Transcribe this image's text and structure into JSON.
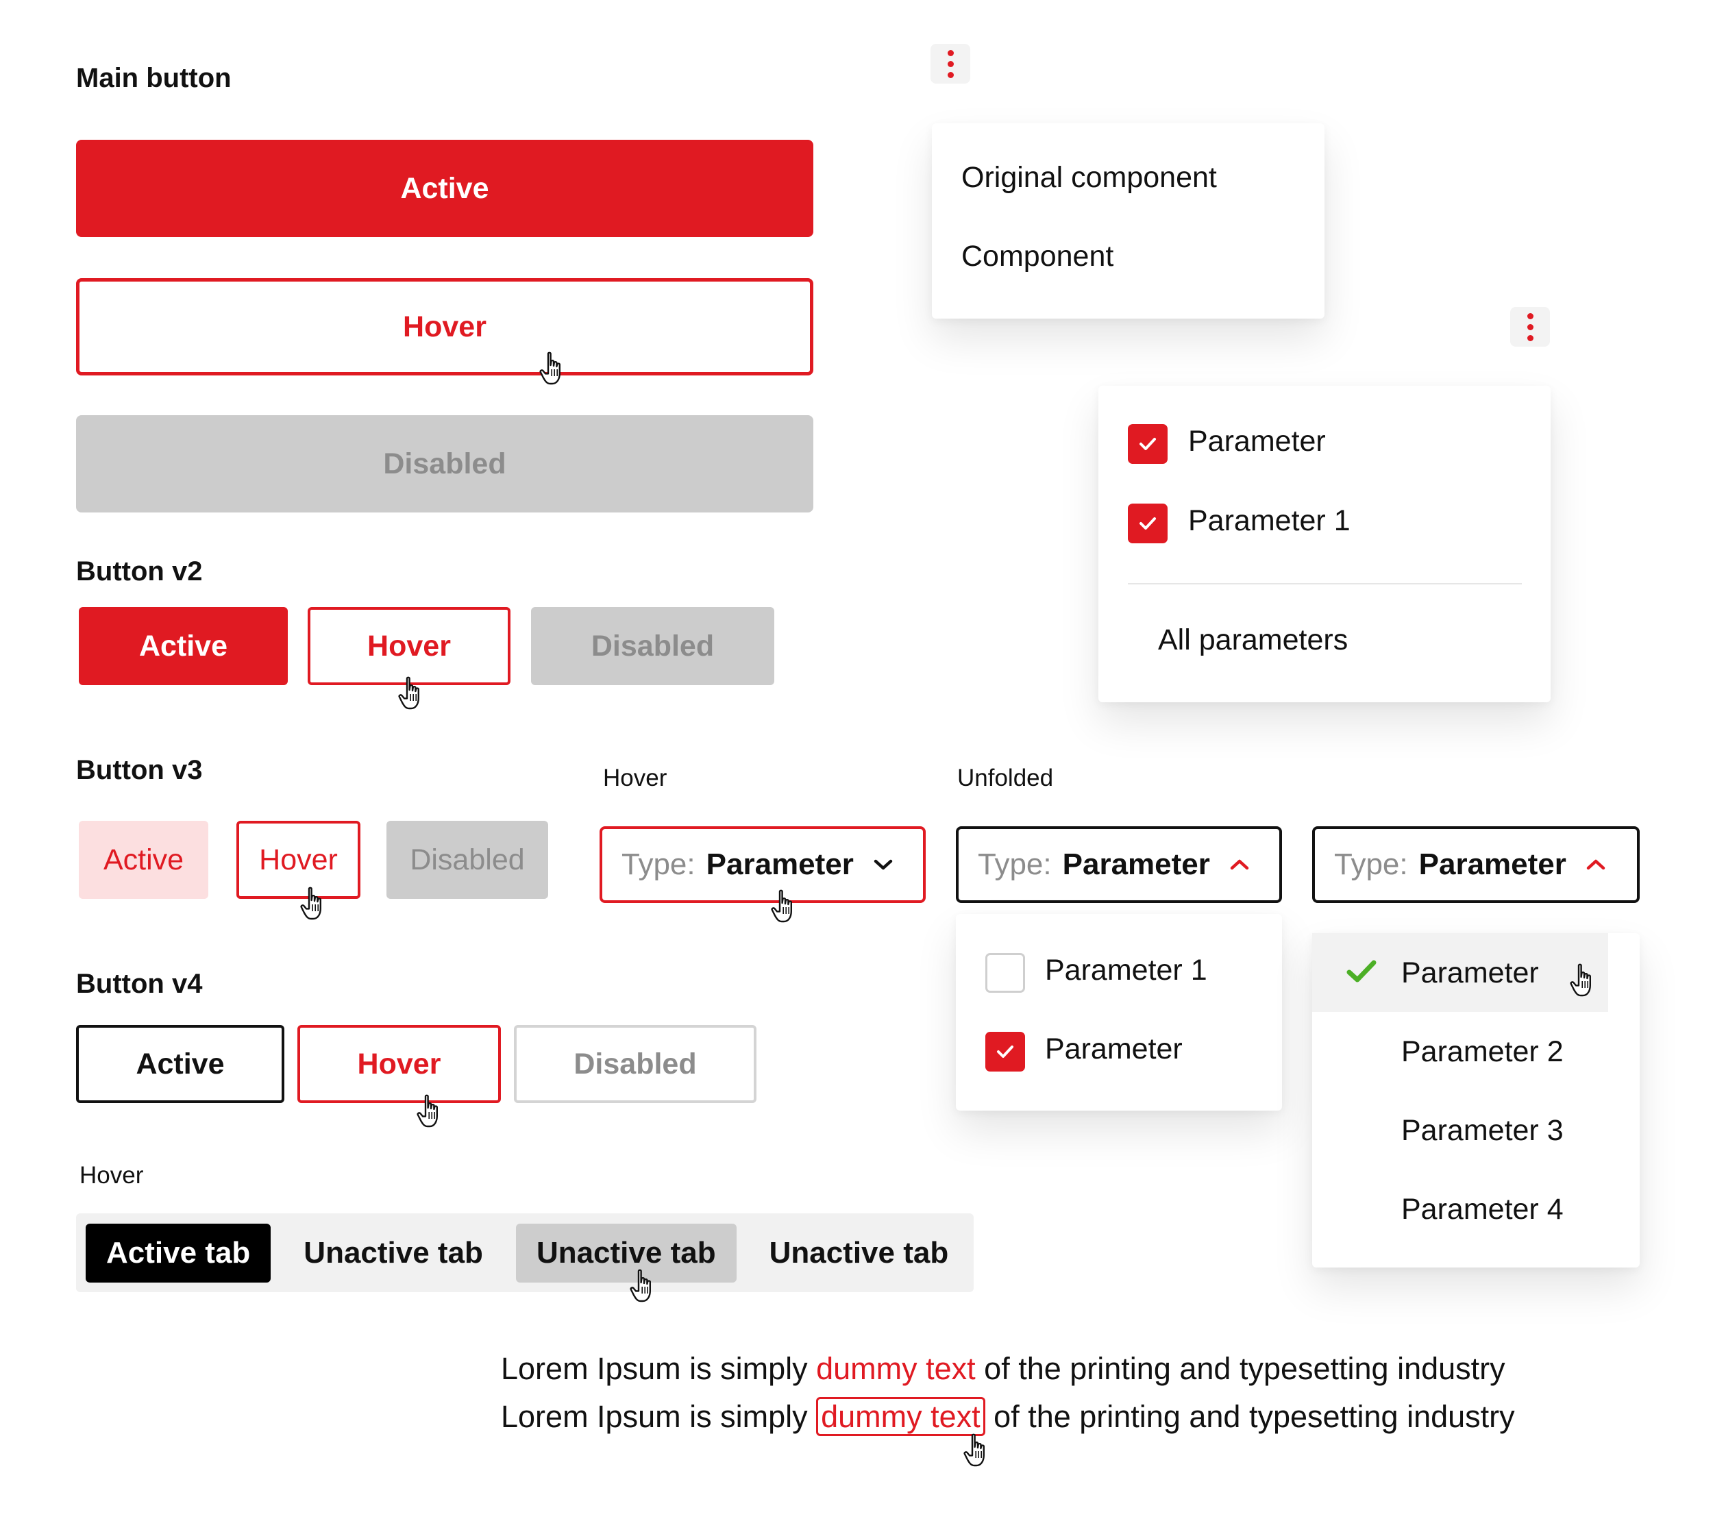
{
  "main_button": {
    "title": "Main button",
    "active": "Active",
    "hover": "Hover",
    "disabled": "Disabled"
  },
  "button_v2": {
    "title": "Button v2",
    "active": "Active",
    "hover": "Hover",
    "disabled": "Disabled"
  },
  "button_v3": {
    "title": "Button v3",
    "active": "Active",
    "hover": "Hover",
    "disabled": "Disabled"
  },
  "button_v4": {
    "title": "Button v4",
    "active": "Active",
    "hover": "Hover",
    "disabled": "Disabled"
  },
  "context_menu": {
    "items": [
      "Original component",
      "Component"
    ]
  },
  "filter_menu": {
    "items": [
      {
        "label": "Parameter",
        "checked": true
      },
      {
        "label": "Parameter 1",
        "checked": true
      }
    ],
    "footer": "All parameters"
  },
  "select_hover": {
    "caption": "Hover",
    "label": "Type:",
    "value": "Parameter"
  },
  "select_unfolded": {
    "caption": "Unfolded",
    "label": "Type:",
    "value": "Parameter",
    "options": [
      {
        "label": "Parameter 1",
        "checked": false
      },
      {
        "label": "Parameter",
        "checked": true
      }
    ]
  },
  "select_single": {
    "label": "Type:",
    "value": "Parameter",
    "options": [
      "Parameter",
      "Parameter 2",
      "Parameter 3",
      "Parameter 4"
    ]
  },
  "tabs": {
    "caption": "Hover",
    "items": [
      "Active tab",
      "Unactive tab",
      "Unactive tab",
      "Unactive tab"
    ]
  },
  "links": {
    "before": "Lorem Ipsum is simply ",
    "link": "dummy text",
    "after": " of the printing and typesetting industry"
  },
  "colors": {
    "accent": "#e01a22",
    "disabled_bg": "#cccccc",
    "disabled_text": "#8c8c8c",
    "soft_pink": "#fcdfe0",
    "check_green": "#4caf26"
  },
  "icons": [
    "hand-cursor-icon",
    "kebab-menu-icon",
    "check-icon",
    "chevron-down-icon",
    "chevron-up-icon"
  ]
}
